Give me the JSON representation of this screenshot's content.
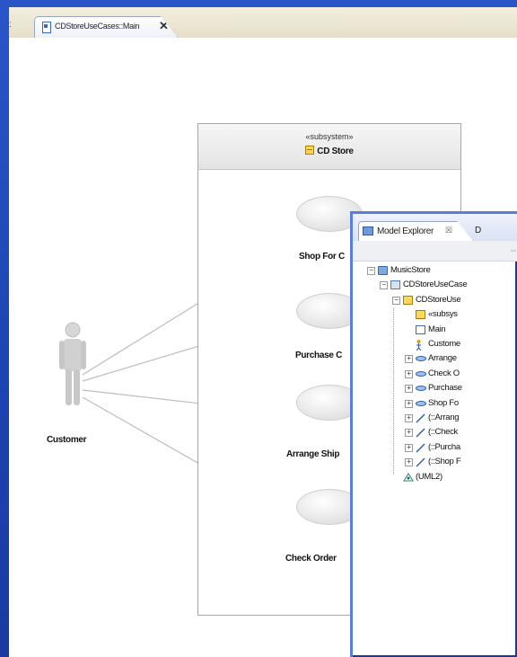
{
  "editor": {
    "tab_title": "CDStoreUseCases::Main",
    "close_glyph": "✕",
    "file_icon": "diagram-file-icon"
  },
  "diagram": {
    "subsystem": {
      "stereotype": "«subsystem»",
      "name": "CD Store"
    },
    "actor": {
      "label": "Customer"
    },
    "use_cases": [
      {
        "label": "Shop For C"
      },
      {
        "label": "Purchase C"
      },
      {
        "label": "Arrange Ship"
      },
      {
        "label": "Check Order"
      }
    ]
  },
  "model_explorer": {
    "tab_label": "Model Explorer",
    "tab_close_glyph": "☒",
    "second_tab_label": "D",
    "tree": [
      {
        "level": 0,
        "toggle": "−",
        "icon": "folder",
        "label": "MusicStore"
      },
      {
        "level": 1,
        "toggle": "−",
        "icon": "model",
        "label": "CDStoreUseCase"
      },
      {
        "level": 2,
        "toggle": "−",
        "icon": "pkg",
        "label": "CDStoreUse"
      },
      {
        "level": 3,
        "toggle": "",
        "icon": "pkg",
        "label": "«subsys"
      },
      {
        "level": 3,
        "toggle": "",
        "icon": "diagram",
        "label": "Main"
      },
      {
        "level": 3,
        "toggle": "",
        "icon": "actor-i",
        "label": "Custome"
      },
      {
        "level": 3,
        "toggle": "+",
        "icon": "uc",
        "label": "Arrange"
      },
      {
        "level": 3,
        "toggle": "+",
        "icon": "uc",
        "label": "Check O"
      },
      {
        "level": 3,
        "toggle": "+",
        "icon": "uc",
        "label": "Purchase"
      },
      {
        "level": 3,
        "toggle": "+",
        "icon": "uc",
        "label": "Shop Fo"
      },
      {
        "level": 3,
        "toggle": "+",
        "icon": "assoc-i",
        "label": "(::Arrang"
      },
      {
        "level": 3,
        "toggle": "+",
        "icon": "assoc-i",
        "label": "(::Check"
      },
      {
        "level": 3,
        "toggle": "+",
        "icon": "assoc-i",
        "label": "(::Purcha"
      },
      {
        "level": 3,
        "toggle": "+",
        "icon": "assoc-i",
        "label": "(::Shop F"
      },
      {
        "level": 2,
        "toggle": "",
        "icon": "uml",
        "label": "(UML2)"
      }
    ]
  },
  "colors": {
    "frame_blue": "#1d43b0",
    "explorer_border": "#5a7de0",
    "usecase_fill": "#e2e2e2",
    "package_yellow": "#ffd85a"
  }
}
